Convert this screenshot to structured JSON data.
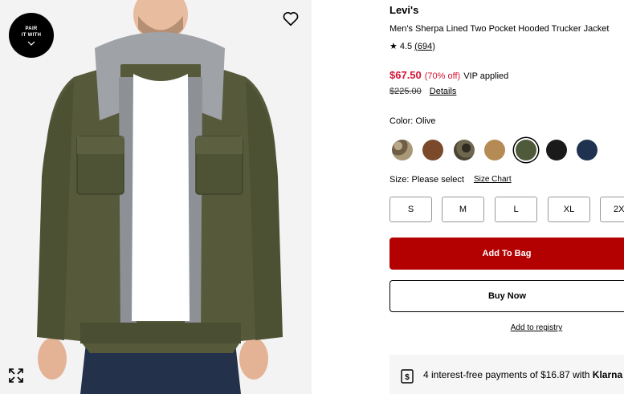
{
  "image_pane": {
    "pair_badge": {
      "line1": "PAIR",
      "line2": "IT WITH"
    },
    "icons": {
      "wishlist": "heart-icon",
      "zoom": "expand-icon",
      "badge_chevron": "chevron-down-icon"
    }
  },
  "product": {
    "brand": "Levi's",
    "name": "Men's Sherpa Lined Two Pocket Hooded Trucker Jacket",
    "rating": {
      "star": "★",
      "value": "4.5",
      "count": "(694)"
    },
    "price": {
      "sale": "$67.50",
      "discount": "(70% off)",
      "vip": "VIP applied",
      "original": "$225.00",
      "details_label": "Details"
    },
    "color": {
      "label": "Color: Olive",
      "swatches": [
        {
          "name": "camo-tan",
          "color": "#8a7a60"
        },
        {
          "name": "brown",
          "color": "#7a4a2a"
        },
        {
          "name": "camo-dark",
          "color": "#5a5240"
        },
        {
          "name": "tan",
          "color": "#b68a55"
        },
        {
          "name": "olive",
          "color": "#4f5a3a",
          "selected": true
        },
        {
          "name": "black",
          "color": "#1a1a1a"
        },
        {
          "name": "navy",
          "color": "#1f3350"
        }
      ]
    },
    "size": {
      "label": "Size: Please select",
      "chart_label": "Size Chart",
      "options": [
        "S",
        "M",
        "L",
        "XL",
        "2X"
      ]
    },
    "actions": {
      "add_to_bag": "Add To Bag",
      "buy_now": "Buy Now",
      "registry": "Add to registry"
    },
    "klarna": {
      "text": "4 interest-free payments of $16.87 with ",
      "brand": "Klarna",
      "icon": "dollar-tag-icon"
    }
  },
  "colors": {
    "sale_red": "#d31334",
    "bag_button": "#b30000"
  }
}
